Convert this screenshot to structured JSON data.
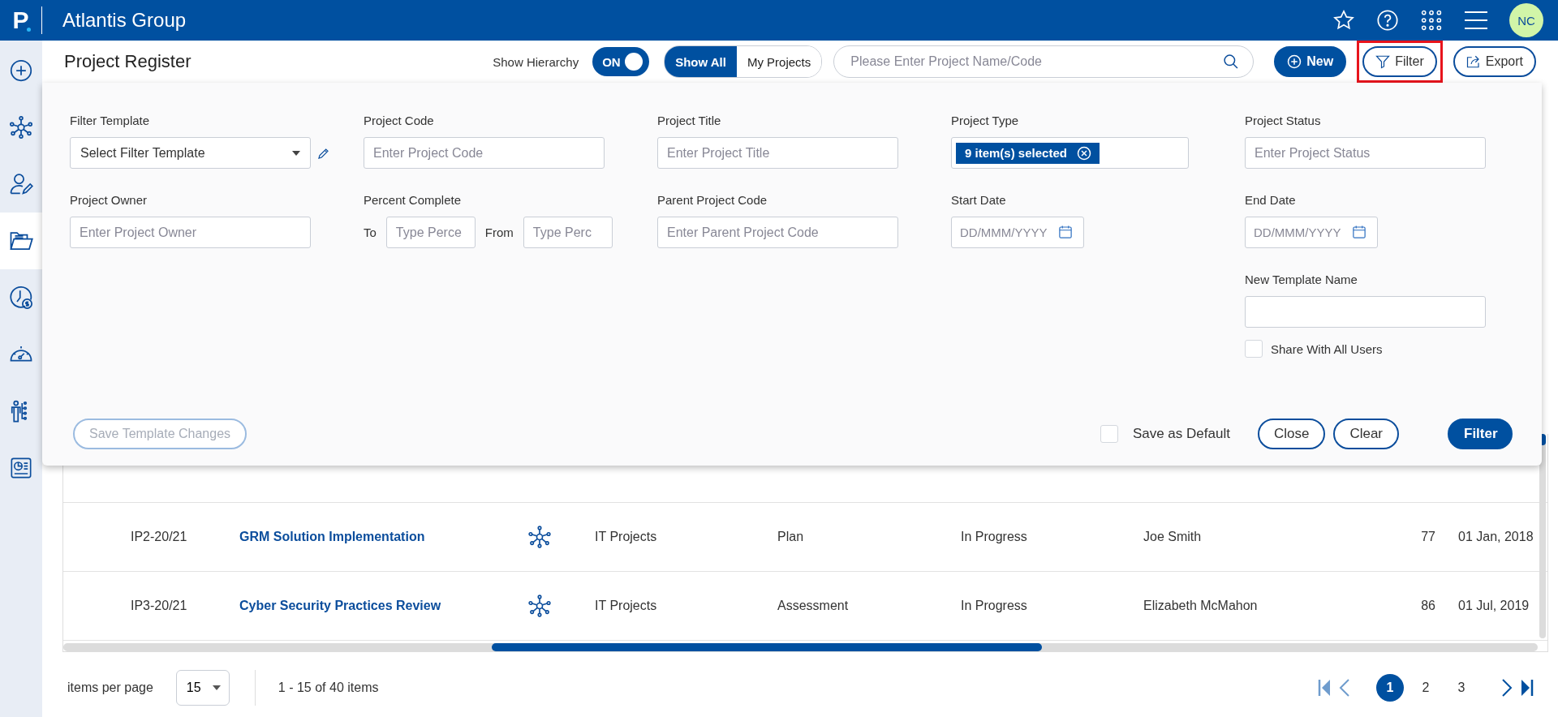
{
  "header": {
    "logo": "P",
    "title": "Atlantis Group",
    "avatar": "NC"
  },
  "sidebar": {
    "items": [
      {
        "kind": "add",
        "selected": false
      },
      {
        "kind": "network",
        "selected": false
      },
      {
        "kind": "user-edit",
        "selected": false
      },
      {
        "kind": "folder",
        "selected": true
      },
      {
        "kind": "clock-dollar",
        "selected": false
      },
      {
        "kind": "gauge",
        "selected": false
      },
      {
        "kind": "org",
        "selected": false
      },
      {
        "kind": "report",
        "selected": false
      }
    ]
  },
  "toolbar": {
    "title": "Project Register",
    "hierarchy_label": "Show Hierarchy",
    "hierarchy_toggle": {
      "label": "ON",
      "on": true
    },
    "segments": [
      {
        "label": "Show All",
        "selected": true
      },
      {
        "label": "My Projects",
        "selected": false
      }
    ],
    "search": {
      "placeholder": "Please Enter Project Name/Code"
    },
    "buttons": [
      {
        "kind": "new",
        "label": "New",
        "highlighted": false
      },
      {
        "kind": "filter",
        "label": "Filter",
        "highlighted": true
      },
      {
        "kind": "export",
        "label": "Export",
        "highlighted": false
      }
    ]
  },
  "filter": {
    "fields": [
      {
        "kind": "select",
        "label": "Filter Template",
        "value": "Select Filter Template"
      },
      {
        "kind": "text",
        "label": "Project Code",
        "placeholder": "Enter Project Code"
      },
      {
        "kind": "text",
        "label": "Project Title",
        "placeholder": "Enter Project Title"
      },
      {
        "kind": "chips",
        "label": "Project Type",
        "chip": "9 item(s) selected"
      },
      {
        "kind": "text",
        "label": "Project Status",
        "placeholder": "Enter Project Status"
      },
      {
        "kind": "text",
        "label": "Project Owner",
        "placeholder": "Enter Project Owner"
      },
      {
        "kind": "range",
        "label": "Percent Complete",
        "to_label": "To",
        "to_placeholder": "Type Perce",
        "from_label": "From",
        "from_placeholder": "Type Perc"
      },
      {
        "kind": "text",
        "label": "Parent Project Code",
        "placeholder": "Enter Parent Project Code"
      },
      {
        "kind": "date",
        "label": "Start Date",
        "placeholder": "DD/MMM/YYYY"
      },
      {
        "kind": "date",
        "label": "End Date",
        "placeholder": "DD/MMM/YYYY"
      },
      {
        "kind": "template",
        "label": "New Template Name",
        "checkbox_label": "Share With All Users",
        "checked": false
      }
    ],
    "save_template": {
      "label": "Save Template Changes",
      "disabled": true
    },
    "save_default": {
      "label": "Save as Default",
      "checked": false
    },
    "buttons": [
      {
        "kind": "outline",
        "label": "Close"
      },
      {
        "kind": "outline",
        "label": "Clear"
      },
      {
        "kind": "primary",
        "label": "Filter"
      }
    ]
  },
  "table": {
    "rows": [
      {
        "code": "IP2-20/21",
        "title": "GRM Solution Implementation",
        "type": "IT Projects",
        "phase": "Plan",
        "status": "In Progress",
        "owner": "Joe Smith",
        "percent": "77",
        "date": "01 Jan, 2018"
      },
      {
        "code": "IP3-20/21",
        "title": "Cyber Security Practices Review",
        "type": "IT Projects",
        "phase": "Assessment",
        "status": "In Progress",
        "owner": "Elizabeth McMahon",
        "percent": "86",
        "date": "01 Jul, 2019"
      }
    ]
  },
  "pager": {
    "per_page_label": "items per page",
    "per_page": "15",
    "range": "1 - 15 of 40 items",
    "prev_disabled": true,
    "next_disabled": false,
    "pages": [
      {
        "label": "1",
        "selected": true
      },
      {
        "label": "2",
        "selected": false
      },
      {
        "label": "3",
        "selected": false
      }
    ]
  }
}
